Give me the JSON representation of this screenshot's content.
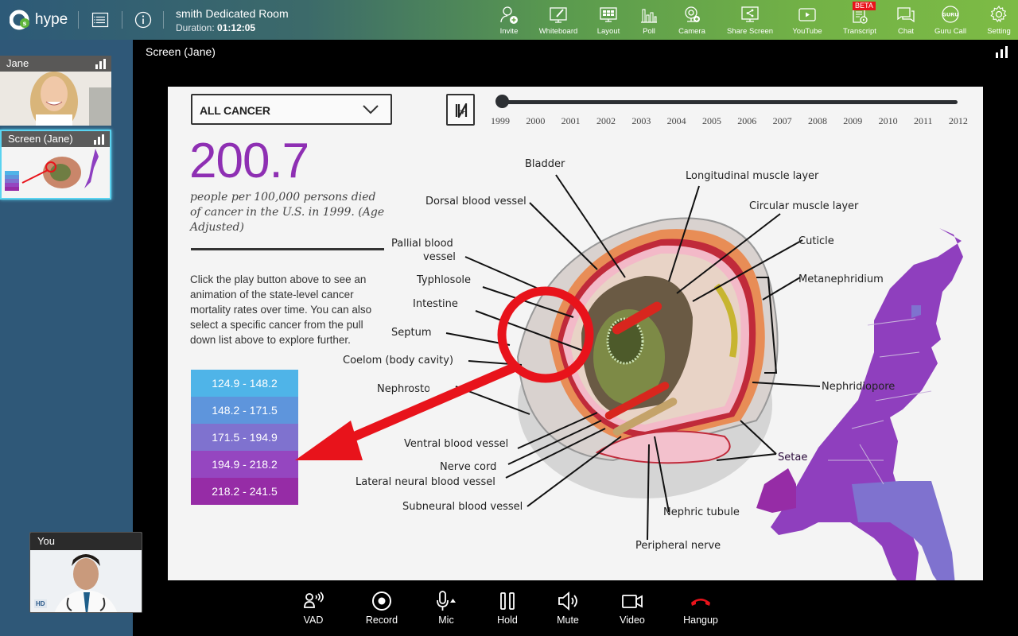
{
  "app": {
    "brand": "hype",
    "room_name": "smith Dedicated Room",
    "duration_label": "Duration:",
    "duration_value": "01:12:05"
  },
  "toolbar": [
    {
      "id": "invite",
      "label": "Invite",
      "icon": "invite-icon"
    },
    {
      "id": "whiteboard",
      "label": "Whiteboard",
      "icon": "whiteboard-icon"
    },
    {
      "id": "layout",
      "label": "Layout",
      "icon": "layout-icon"
    },
    {
      "id": "poll",
      "label": "Poll",
      "icon": "poll-icon"
    },
    {
      "id": "camera",
      "label": "Camera",
      "icon": "camera-icon"
    },
    {
      "id": "share-screen",
      "label": "Share Screen",
      "icon": "share-screen-icon"
    },
    {
      "id": "youtube",
      "label": "YouTube",
      "icon": "youtube-icon"
    },
    {
      "id": "transcript",
      "label": "Transcript",
      "icon": "transcript-icon",
      "badge": "BETA"
    },
    {
      "id": "chat",
      "label": "Chat",
      "icon": "chat-icon"
    },
    {
      "id": "guru-call",
      "label": "Guru Call",
      "icon": "guru-call-icon",
      "icon_text": "GURU"
    },
    {
      "id": "setting",
      "label": "Setting",
      "icon": "gear-icon"
    }
  ],
  "participants": [
    {
      "name": "Jane",
      "type": "camera"
    },
    {
      "name": "Screen (Jane)",
      "type": "screen",
      "active": true
    }
  ],
  "self_view": {
    "label": "You",
    "quality_badge": "HD"
  },
  "main_view": {
    "title": "Screen (Jane)"
  },
  "shared_screen": {
    "dropdown_value": "ALL CANCER",
    "years": [
      "1999",
      "2000",
      "2001",
      "2002",
      "2003",
      "2004",
      "2005",
      "2006",
      "2007",
      "2008",
      "2009",
      "2010",
      "2011",
      "2012"
    ],
    "selected_year": "1999",
    "headline_value": "200.7",
    "headline_desc": "people per 100,000 persons died of cancer in the U.S. in 1999. (Age Adjusted)",
    "instructions": "Click the play button above to see an animation of the state-level cancer mortality rates over time. You can also select a specific cancer from the pull down list above to explore further.",
    "legend": [
      {
        "range": "124.9 - 148.2",
        "color": "#4fb4e8"
      },
      {
        "range": "148.2 - 171.5",
        "color": "#5e95dc"
      },
      {
        "range": "171.5 - 194.9",
        "color": "#7f72cf"
      },
      {
        "range": "194.9 - 218.2",
        "color": "#9546c0"
      },
      {
        "range": "218.2 - 241.5",
        "color": "#962ca6"
      }
    ],
    "diagram_labels": {
      "bladder": "Bladder",
      "dorsal": "Dorsal blood vessel",
      "longitudinal": "Longitudinal muscle layer",
      "circular": "Circular muscle layer",
      "pallial_1": "Pallial blood",
      "pallial_2": "vessel",
      "cuticle": "Cuticle",
      "typhlosole": "Typhlosole",
      "metanephridium": "Metanephridium",
      "intestine": "Intestine",
      "septum": "Septum",
      "coelom": "Coelom (body cavity)",
      "nephrostome": "Nephrostome",
      "nephridiopore": "Nephridiopore",
      "ventral": "Ventral blood vessel",
      "setae": "Setae",
      "nerve_cord": "Nerve cord",
      "lateral": "Lateral neural blood vessel",
      "subneural": "Subneural blood vessel",
      "nephric": "Nephric tubule",
      "peripheral": "Peripheral nerve"
    }
  },
  "controls": [
    {
      "id": "vad",
      "label": "VAD",
      "icon": "vad-icon"
    },
    {
      "id": "record",
      "label": "Record",
      "icon": "record-icon"
    },
    {
      "id": "mic",
      "label": "Mic",
      "icon": "mic-icon"
    },
    {
      "id": "hold",
      "label": "Hold",
      "icon": "hold-icon"
    },
    {
      "id": "mute",
      "label": "Mute",
      "icon": "speaker-icon"
    },
    {
      "id": "video",
      "label": "Video",
      "icon": "video-icon"
    },
    {
      "id": "hangup",
      "label": "Hangup",
      "icon": "hangup-icon",
      "color": "#e8131b"
    }
  ]
}
